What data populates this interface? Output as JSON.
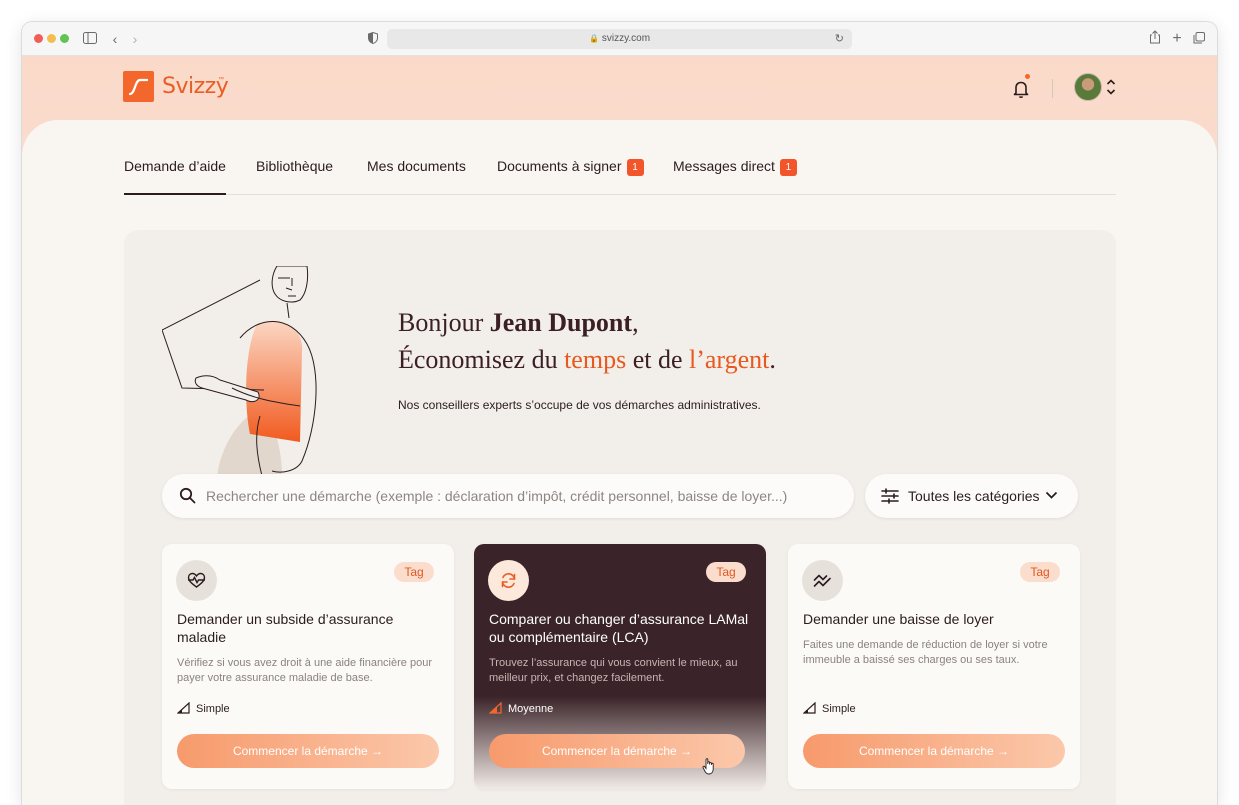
{
  "browser": {
    "url": "svizzy.com"
  },
  "brand": {
    "name": "Svizzy",
    "tm": "™",
    "accent": "#f3672d"
  },
  "tabs": [
    {
      "label": "Demande d’aide",
      "active": true
    },
    {
      "label": "Bibliothèque"
    },
    {
      "label": "Mes documents"
    },
    {
      "label": "Documents à signer",
      "badge": "1"
    },
    {
      "label": "Messages direct",
      "badge": "1"
    }
  ],
  "hero": {
    "hello": "Bonjour ",
    "name": "Jean Dupont",
    "comma": ",",
    "line2_a": "Économisez du ",
    "line2_b": "temps",
    "line2_c": " et de ",
    "line2_d": "l’argent",
    "line2_e": ".",
    "subtitle": "Nos conseillers experts s’occupe de vos démarches administratives."
  },
  "search": {
    "placeholder": "Rechercher une démarche (exemple : déclaration d’impôt, crédit personnel, baisse de loyer...)",
    "icon": "search-icon"
  },
  "filter": {
    "label": "Toutes les catégories",
    "icon": "sliders-icon"
  },
  "cards": [
    {
      "icon": "heart-pulse-icon",
      "tag": "Tag",
      "title": "Demander un subside d’assurance maladie",
      "description": "Vérifiez si vous avez droit à une aide financière pour payer votre assurance maladie de base.",
      "level": "Simple",
      "cta": "Commencer la démarche  →"
    },
    {
      "icon": "refresh-icon",
      "tag": "Tag",
      "title": "Comparer ou changer d’assurance LAMal ou complémentaire (LCA)",
      "description": "Trouvez l’assurance qui vous convient le mieux, au meilleur prix, et changez facilement.",
      "level": "Moyenne",
      "cta": "Commencer la démarche  →"
    },
    {
      "icon": "trend-down-icon",
      "tag": "Tag",
      "title": "Demander une baisse de loyer",
      "description": "Faites une demande de réduction de loyer si votre immeuble a baissé ses charges ou ses taux.",
      "level": "Simple",
      "cta": "Commencer la démarche  →"
    }
  ]
}
